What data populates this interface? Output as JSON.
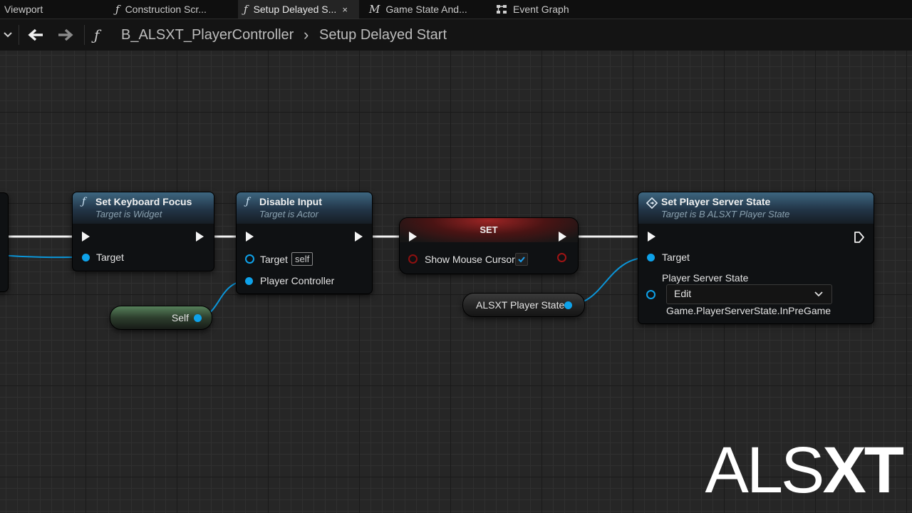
{
  "tabs": [
    {
      "label": "Viewport",
      "icon": ""
    },
    {
      "label": "Construction Scr...",
      "icon": "ƒ"
    },
    {
      "label": "Setup Delayed S...",
      "icon": "ƒ",
      "close": "×"
    },
    {
      "label": "Game State And...",
      "icon": "M"
    },
    {
      "label": "Event Graph",
      "icon": "graph-icon"
    }
  ],
  "breadcrumb": {
    "func_icon": "ƒ",
    "blueprint": "B_ALSXT_PlayerController",
    "separator": "›",
    "function": "Setup Delayed Start"
  },
  "nodes": {
    "set_keyboard_focus": {
      "title": "Set Keyboard Focus",
      "subtitle": "Target is Widget",
      "icon": "ƒ",
      "pins": {
        "target": "Target"
      }
    },
    "disable_input": {
      "title": "Disable Input",
      "subtitle": "Target is Actor",
      "icon": "ƒ",
      "pins": {
        "target": "Target",
        "target_default": "self",
        "player_controller": "Player Controller"
      }
    },
    "set": {
      "title": "SET",
      "pins": {
        "show_mouse_cursor": "Show Mouse Cursor",
        "checked": true
      }
    },
    "set_player_server_state": {
      "title": "Set Player Server State",
      "subtitle": "Target is B ALSXT Player State",
      "pins": {
        "target": "Target",
        "player_server_state": "Player Server State",
        "dropdown": "Edit",
        "tag": "Game.PlayerServerState.InPreGame"
      }
    }
  },
  "variables": {
    "self": "Self",
    "player_state": "ALSXT Player State"
  },
  "watermark": {
    "light": "ALS",
    "bold": "XT"
  },
  "colors": {
    "exec": "#f4f4f4",
    "object_pin": "#0ea2ea",
    "bool_pin": "#8e1010",
    "function_header": "#2f5670",
    "set_header": "#7a1a1a",
    "self_node": "#3e5a3e"
  }
}
